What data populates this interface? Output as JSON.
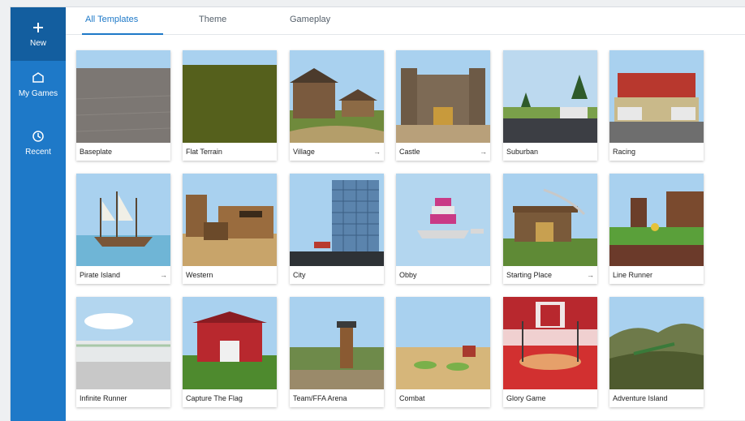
{
  "sidebar": {
    "items": [
      {
        "label": "New",
        "icon": "plus-icon"
      },
      {
        "label": "My Games",
        "icon": "folder-icon"
      },
      {
        "label": "Recent",
        "icon": "clock-icon"
      }
    ]
  },
  "tabs": [
    {
      "label": "All Templates",
      "active": true
    },
    {
      "label": "Theme",
      "active": false
    },
    {
      "label": "Gameplay",
      "active": false
    }
  ],
  "templates": [
    {
      "name": "Baseplate"
    },
    {
      "name": "Flat Terrain"
    },
    {
      "name": "Village",
      "icon": "→"
    },
    {
      "name": "Castle",
      "icon": "→"
    },
    {
      "name": "Suburban"
    },
    {
      "name": "Racing"
    },
    {
      "name": "Pirate Island",
      "icon": "→"
    },
    {
      "name": "Western"
    },
    {
      "name": "City"
    },
    {
      "name": "Obby"
    },
    {
      "name": "Starting Place",
      "icon": "→"
    },
    {
      "name": "Line Runner"
    },
    {
      "name": "Infinite Runner"
    },
    {
      "name": "Capture The Flag"
    },
    {
      "name": "Team/FFA Arena"
    },
    {
      "name": "Combat"
    },
    {
      "name": "Glory Game"
    },
    {
      "name": "Adventure Island"
    }
  ]
}
